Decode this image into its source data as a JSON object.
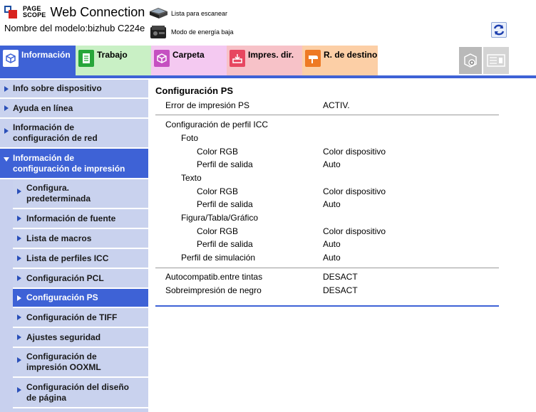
{
  "header": {
    "logo_small_line1": "PAGE",
    "logo_small_line2": "SCOPE",
    "title": "Web Connection",
    "model": "Nombre del modelo:bizhub C224e",
    "scan_list_label": "Lista para escanear",
    "low_power_label": "Modo de energía baja"
  },
  "tabs": [
    {
      "label": "Información"
    },
    {
      "label": "Trabajo"
    },
    {
      "label": "Carpeta"
    },
    {
      "label": "Impres. dir."
    },
    {
      "label": "R. de destino"
    }
  ],
  "sidebar": {
    "items": [
      {
        "label": "Info sobre dispositivo"
      },
      {
        "label": "Ayuda en línea"
      },
      {
        "label_l1": "Información de",
        "label_l2": "configuración de red"
      },
      {
        "label_l1": "Información de",
        "label_l2": "configuración de impresión"
      }
    ],
    "sub_items": [
      {
        "label_l1": "Configura.",
        "label_l2": "predeterminada"
      },
      {
        "label": "Información de fuente"
      },
      {
        "label": "Lista de macros"
      },
      {
        "label": "Lista de perfiles ICC"
      },
      {
        "label": "Configuración PCL"
      },
      {
        "label": "Configuración PS"
      },
      {
        "label": "Configuración de TIFF"
      },
      {
        "label": "Ajustes seguridad"
      },
      {
        "label_l1": "Configuración de",
        "label_l2": "impresión OOXML"
      },
      {
        "label_l1": "Configuración del diseño",
        "label_l2": "de página"
      }
    ]
  },
  "main": {
    "title": "Configuración PS",
    "rows": [
      {
        "label": "Error de impresión PS",
        "value": "ACTIV."
      },
      {
        "label": "Configuración de perfil ICC",
        "value": ""
      },
      {
        "label": "Foto",
        "value": ""
      },
      {
        "label": "Color RGB",
        "value": "Color dispositivo"
      },
      {
        "label": "Perfil de salida",
        "value": "Auto"
      },
      {
        "label": "Texto",
        "value": ""
      },
      {
        "label": "Color RGB",
        "value": "Color dispositivo"
      },
      {
        "label": "Perfil de salida",
        "value": "Auto"
      },
      {
        "label": "Figura/Tabla/Gráfico",
        "value": ""
      },
      {
        "label": "Color RGB",
        "value": "Color dispositivo"
      },
      {
        "label": "Perfil de salida",
        "value": "Auto"
      },
      {
        "label": "Perfil de simulación",
        "value": "Auto"
      },
      {
        "label": "Autocompatib.entre tintas",
        "value": "DESACT"
      },
      {
        "label": "Sobreimpresión de negro",
        "value": "DESACT"
      }
    ]
  },
  "icons": {
    "refresh": "refresh-icon",
    "scan": "scanner-icon",
    "power": "low-power-icon",
    "gear": "admin-gear-icon",
    "panel": "control-panel-icon"
  },
  "colors": {
    "accent": "#3e62d6",
    "sidebar_bg": "#c9d2ee"
  }
}
